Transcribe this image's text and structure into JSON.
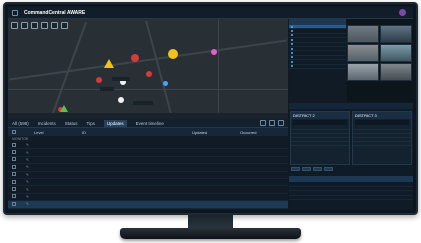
{
  "app": {
    "title": "CommandCentral AWARE",
    "tabs": [
      "",
      "",
      ""
    ],
    "user": ""
  },
  "map": {
    "footer": ""
  },
  "table": {
    "tabs": [
      {
        "label": "All (598)"
      },
      {
        "label": "Incidents"
      },
      {
        "label": "Status"
      },
      {
        "label": "Tips"
      },
      {
        "label": "Updates"
      },
      {
        "label": "Event timeline"
      }
    ],
    "headers": [
      "Level",
      "ID",
      "Updated",
      "Occurred"
    ],
    "group_label": "MONITOR",
    "rows": [
      {
        "level": "",
        "id": "",
        "updated": "",
        "occurred": ""
      },
      {
        "level": "",
        "id": "",
        "updated": "",
        "occurred": ""
      },
      {
        "level": "",
        "id": "",
        "updated": "",
        "occurred": ""
      },
      {
        "level": "",
        "id": "",
        "updated": "",
        "occurred": ""
      },
      {
        "level": "",
        "id": "",
        "updated": "",
        "occurred": ""
      },
      {
        "level": "",
        "id": "",
        "updated": "",
        "occurred": ""
      },
      {
        "level": "",
        "id": "",
        "updated": "",
        "occurred": ""
      },
      {
        "level": "",
        "id": "",
        "updated": "",
        "occurred": ""
      },
      {
        "level": "",
        "id": "",
        "updated": "",
        "occurred": ""
      }
    ]
  },
  "units": {
    "title": "",
    "rows": [
      "",
      "",
      "",
      "",
      "",
      "",
      "",
      "",
      "",
      ""
    ]
  },
  "cameras": {
    "labels": [
      "",
      "",
      "",
      "",
      "",
      ""
    ]
  },
  "districts": {
    "header": "",
    "panels": [
      {
        "title": "DISTRICT 2",
        "rows": [
          [
            "",
            ""
          ],
          [
            "",
            ""
          ],
          [
            "",
            ""
          ],
          [
            "",
            ""
          ],
          [
            "",
            ""
          ]
        ]
      },
      {
        "title": "DISTRICT 3",
        "rows": [
          [
            "",
            ""
          ],
          [
            "",
            ""
          ],
          [
            "",
            ""
          ],
          [
            "",
            ""
          ],
          [
            "",
            ""
          ]
        ]
      }
    ]
  },
  "lower": {
    "title": "",
    "rows": [
      [
        "",
        "",
        ""
      ],
      [
        "",
        "",
        ""
      ],
      [
        "",
        "",
        ""
      ],
      [
        "",
        "",
        ""
      ]
    ]
  }
}
